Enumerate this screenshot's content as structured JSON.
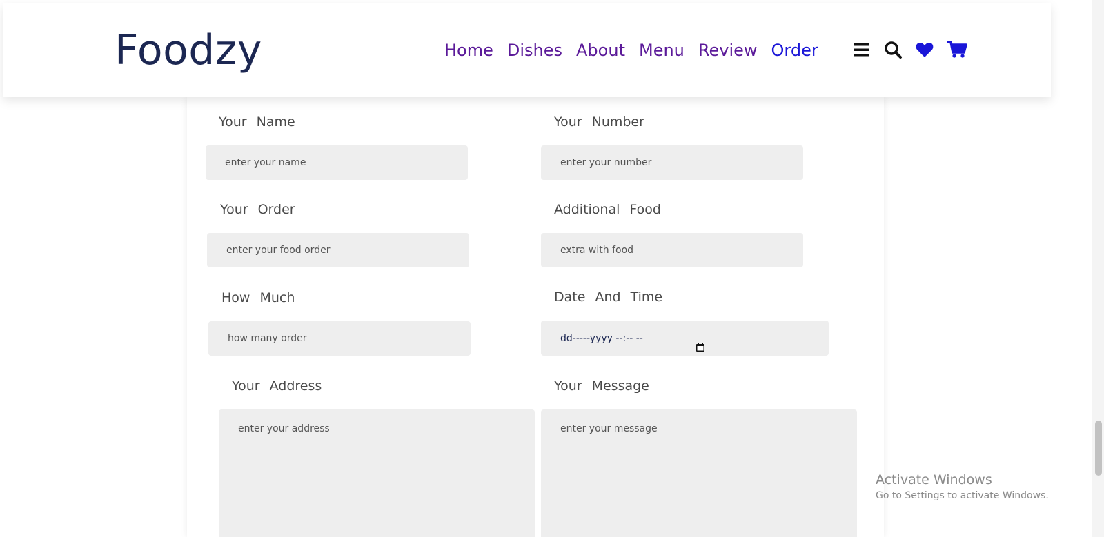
{
  "header": {
    "logo": "Foodzy",
    "nav": [
      "Home",
      "Dishes",
      "About",
      "Menu",
      "Review",
      "Order"
    ],
    "active_nav": "Order",
    "icons": [
      "bars-icon",
      "search-icon",
      "heart-icon",
      "cart-icon"
    ],
    "colors": {
      "logo": "#1c2752",
      "nav": "#5b1a99",
      "active": "#1a16d8",
      "heart": "#1a16d8",
      "cart": "#1a16d8"
    }
  },
  "form": {
    "name": {
      "label": "Your Name",
      "placeholder": "enter your name"
    },
    "number": {
      "label": "Your Number",
      "placeholder": "enter your number"
    },
    "order": {
      "label": "Your Order",
      "placeholder": "enter your food order"
    },
    "additional": {
      "label": "Additional Food",
      "placeholder": "extra with food"
    },
    "how_much": {
      "label": "How Much",
      "placeholder": "how many order"
    },
    "datetime": {
      "label": "Date And Time",
      "placeholder": "dd-----yyyy --:-- --"
    },
    "address": {
      "label": "Your Address",
      "placeholder": "enter your address"
    },
    "message": {
      "label": "Your Message",
      "placeholder": "enter your message"
    }
  },
  "overlay": {
    "activate_title": "Activate Windows",
    "activate_sub": "Go to Settings to activate Windows."
  }
}
